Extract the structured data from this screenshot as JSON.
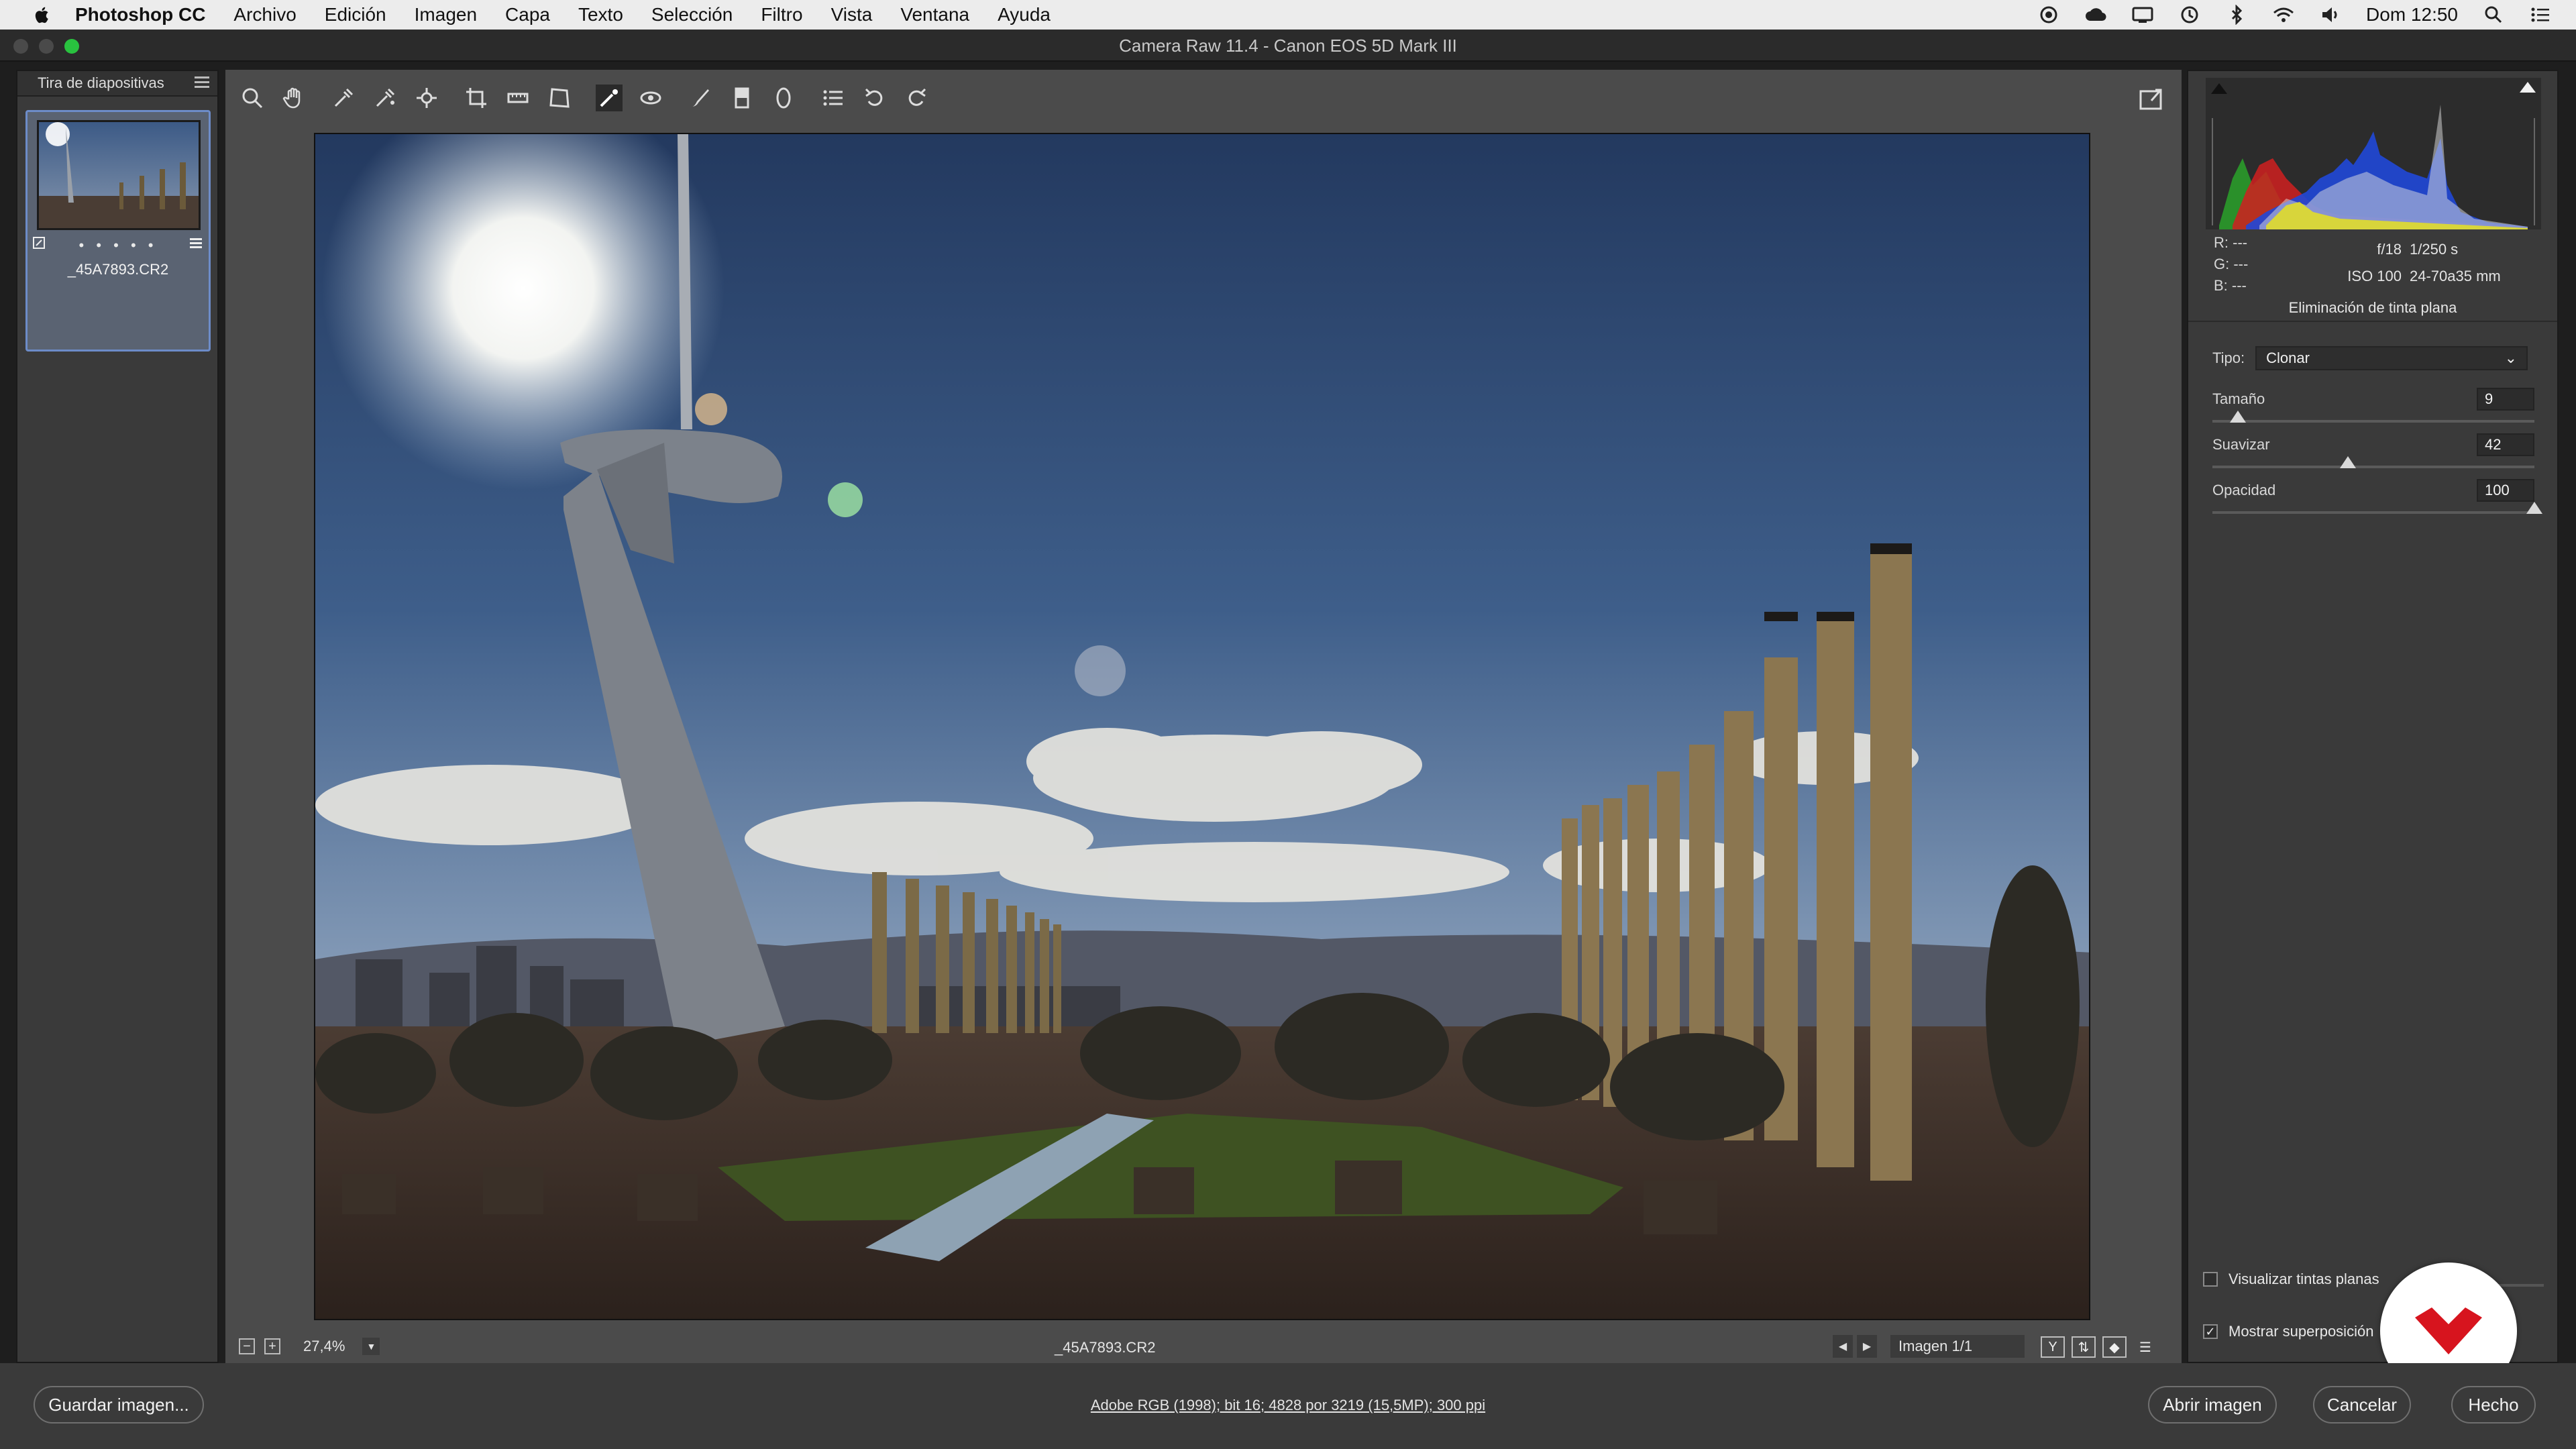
{
  "menubar": {
    "app_name": "Photoshop CC",
    "items": [
      "Archivo",
      "Edición",
      "Imagen",
      "Capa",
      "Texto",
      "Selección",
      "Filtro",
      "Vista",
      "Ventana",
      "Ayuda"
    ],
    "clock": "Dom 12:50"
  },
  "window": {
    "title": "Camera Raw 11.4 -  Canon EOS 5D Mark III"
  },
  "filmstrip": {
    "header": "Tira de diapositivas",
    "thumb_rating": "• • • • •",
    "thumb_name": "_45A7893.CR2"
  },
  "preview": {
    "zoom": "27,4%",
    "file_name": "_45A7893.CR2",
    "image_count": "Imagen 1/1",
    "view_button_y": "Y"
  },
  "panel": {
    "rgb": {
      "r": "R:  ---",
      "g": "G:  ---",
      "b": "B:  ---"
    },
    "exif": {
      "aperture": "f/18",
      "shutter": "1/250 s",
      "iso": "ISO 100",
      "lens": "24-70a35 mm"
    },
    "title": "Eliminación de tinta plana",
    "tipo_label": "Tipo:",
    "tipo_value": "Clonar",
    "sliders": [
      {
        "label": "Tamaño",
        "value": "9",
        "fraction": 0.08
      },
      {
        "label": "Suavizar",
        "value": "42",
        "fraction": 0.42
      },
      {
        "label": "Opacidad",
        "value": "100",
        "fraction": 1.0
      }
    ],
    "visualizar_label": "Visualizar tintas planas",
    "mostrar_label": "Mostrar superposición"
  },
  "bottom": {
    "save_label": "Guardar imagen...",
    "workflow_text": "Adobe RGB (1998); bit 16; 4828 por 3219 (15,5MP); 300 ppi",
    "open_label": "Abrir imagen",
    "cancel_label": "Cancelar",
    "done_label": "Hecho"
  },
  "colors": {
    "accent_selection": "#6d8cc9",
    "badge_red": "#d7141e"
  }
}
